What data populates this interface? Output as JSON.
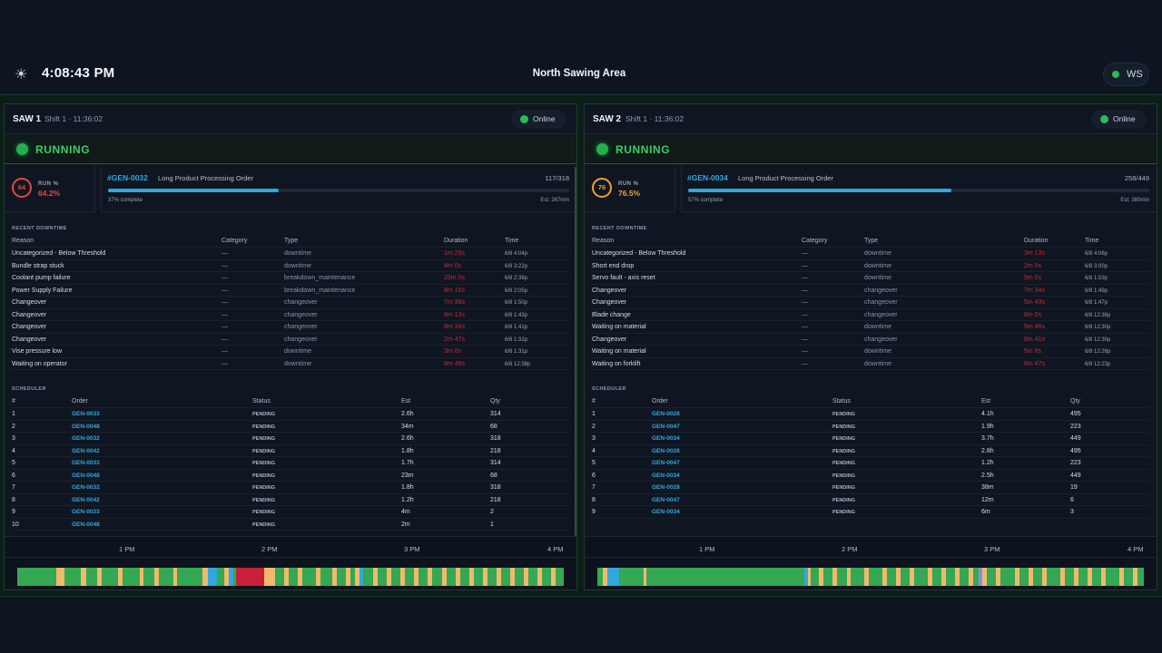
{
  "header": {
    "theme_icon": "sun-icon",
    "clock": "4:08:43 PM",
    "area_title": "North Sawing Area",
    "connection_label": "WS"
  },
  "colors": {
    "running": "#22b04f",
    "online": "#2fba55",
    "downtime": "#c22b3a",
    "changeover": "#f0b96b",
    "progress": "#2fa8de"
  },
  "machines": [
    {
      "name": "SAW 1",
      "shift": "Shift 1 · 11:36:02",
      "status_online": "Online",
      "state": "RUNNING",
      "run_ring": "64",
      "run_label": "RUN %",
      "run_value": "64.2%",
      "run_color": "#e04a45",
      "order_code": "#GEN-0032",
      "order_desc": "Long Product Processing Order",
      "order_qty": "117/318",
      "progress": 0.37,
      "complete_text": "37% complete",
      "est_text": "Est: 267min",
      "downtime_title": "RECENT DOWNTIME",
      "downtime_headers": [
        "Reason",
        "Category",
        "Type",
        "Duration",
        "Time"
      ],
      "downtime": [
        [
          "Uncategorized - Below Threshold",
          "—",
          "downtime",
          "1m 25s",
          "6/8 4:04p"
        ],
        [
          "Bundle strap stuck",
          "—",
          "downtime",
          "4m 0s",
          "6/8 3:22p"
        ],
        [
          "Coolant pump failure",
          "—",
          "breakdown_maintenance",
          "25m 0s",
          "6/8 2:38p"
        ],
        [
          "Power Supply Failure",
          "—",
          "breakdown_maintenance",
          "8m 15s",
          "6/8 2:05p"
        ],
        [
          "Changeover",
          "—",
          "changeover",
          "7m 38s",
          "6/8 1:50p"
        ],
        [
          "Changeover",
          "—",
          "changeover",
          "8m 13s",
          "6/8 1:43p"
        ],
        [
          "Changeover",
          "—",
          "changeover",
          "8m 34s",
          "6/8 1:41p"
        ],
        [
          "Changeover",
          "—",
          "changeover",
          "2m 47s",
          "6/8 1:32p"
        ],
        [
          "Vise pressure low",
          "—",
          "downtime",
          "3m 0s",
          "6/8 1:31p"
        ],
        [
          "Waiting on operator",
          "—",
          "downtime",
          "8m 49s",
          "6/8 12:38p"
        ]
      ],
      "scheduler_title": "SCHEDULER",
      "scheduler_headers": [
        "#",
        "Order",
        "Status",
        "Est",
        "Qty"
      ],
      "scheduler": [
        [
          "1",
          "GEN-0033",
          "PENDING",
          "2.6h",
          "314"
        ],
        [
          "2",
          "GEN-0048",
          "PENDING",
          "34m",
          "68"
        ],
        [
          "3",
          "GEN-0032",
          "PENDING",
          "2.6h",
          "318"
        ],
        [
          "4",
          "GEN-0042",
          "PENDING",
          "1.8h",
          "218"
        ],
        [
          "5",
          "GEN-0033",
          "PENDING",
          "1.7h",
          "314"
        ],
        [
          "6",
          "GEN-0048",
          "PENDING",
          "23m",
          "68"
        ],
        [
          "7",
          "GEN-0032",
          "PENDING",
          "1.8h",
          "318"
        ],
        [
          "8",
          "GEN-0042",
          "PENDING",
          "1.2h",
          "218"
        ],
        [
          "9",
          "GEN-0033",
          "PENDING",
          "4m",
          "2"
        ],
        [
          "10",
          "GEN-0048",
          "PENDING",
          "2m",
          "1"
        ]
      ],
      "timeline_ticks": [
        "1 PM",
        "2 PM",
        "3 PM",
        "4 PM"
      ],
      "timeline_segments": [
        {
          "s": 0.071,
          "e": 0.086,
          "c": "#f0b96b"
        },
        {
          "s": 0.117,
          "e": 0.126,
          "c": "#f0b96b"
        },
        {
          "s": 0.146,
          "e": 0.154,
          "c": "#f0b96b"
        },
        {
          "s": 0.185,
          "e": 0.193,
          "c": "#f0b96b"
        },
        {
          "s": 0.224,
          "e": 0.231,
          "c": "#f0b96b"
        },
        {
          "s": 0.251,
          "e": 0.259,
          "c": "#f0b96b"
        },
        {
          "s": 0.285,
          "e": 0.292,
          "c": "#f0b96b"
        },
        {
          "s": 0.339,
          "e": 0.349,
          "c": "#f0b96b"
        },
        {
          "s": 0.349,
          "e": 0.365,
          "c": "#2fa8de"
        },
        {
          "s": 0.378,
          "e": 0.387,
          "c": "#f0b96b"
        },
        {
          "s": 0.387,
          "e": 0.395,
          "c": "#2fa8de"
        },
        {
          "s": 0.401,
          "e": 0.452,
          "c": "#c8203a"
        },
        {
          "s": 0.452,
          "e": 0.472,
          "c": "#f0b96b"
        },
        {
          "s": 0.488,
          "e": 0.496,
          "c": "#f0b96b"
        },
        {
          "s": 0.513,
          "e": 0.521,
          "c": "#f0b96b"
        },
        {
          "s": 0.546,
          "e": 0.554,
          "c": "#f0b96b"
        },
        {
          "s": 0.576,
          "e": 0.584,
          "c": "#f0b96b"
        },
        {
          "s": 0.601,
          "e": 0.609,
          "c": "#f0b96b"
        },
        {
          "s": 0.618,
          "e": 0.626,
          "c": "#f0b96b"
        },
        {
          "s": 0.626,
          "e": 0.633,
          "c": "#2fa8de"
        },
        {
          "s": 0.651,
          "e": 0.659,
          "c": "#f0b96b"
        },
        {
          "s": 0.676,
          "e": 0.684,
          "c": "#f0b96b"
        },
        {
          "s": 0.701,
          "e": 0.709,
          "c": "#f0b96b"
        },
        {
          "s": 0.726,
          "e": 0.734,
          "c": "#f0b96b"
        },
        {
          "s": 0.751,
          "e": 0.759,
          "c": "#f0b96b"
        },
        {
          "s": 0.777,
          "e": 0.785,
          "c": "#f0b96b"
        },
        {
          "s": 0.802,
          "e": 0.81,
          "c": "#f0b96b"
        },
        {
          "s": 0.827,
          "e": 0.835,
          "c": "#f0b96b"
        },
        {
          "s": 0.852,
          "e": 0.86,
          "c": "#f0b96b"
        },
        {
          "s": 0.877,
          "e": 0.885,
          "c": "#f0b96b"
        },
        {
          "s": 0.902,
          "e": 0.91,
          "c": "#f0b96b"
        },
        {
          "s": 0.927,
          "e": 0.935,
          "c": "#f0b96b"
        },
        {
          "s": 0.952,
          "e": 0.96,
          "c": "#f0b96b"
        },
        {
          "s": 0.977,
          "e": 0.985,
          "c": "#f0b96b"
        }
      ]
    },
    {
      "name": "SAW 2",
      "shift": "Shift 1 · 11:36:02",
      "status_online": "Online",
      "state": "RUNNING",
      "run_ring": "76",
      "run_label": "RUN %",
      "run_value": "76.5%",
      "run_color": "#f0a030",
      "order_code": "#GEN-0034",
      "order_desc": "Long Product Processing Order",
      "order_qty": "258/449",
      "progress": 0.57,
      "complete_text": "57% complete",
      "est_text": "Est: 380min",
      "downtime_title": "RECENT DOWNTIME",
      "downtime_headers": [
        "Reason",
        "Category",
        "Type",
        "Duration",
        "Time"
      ],
      "downtime": [
        [
          "Uncategorized - Below Threshold",
          "—",
          "downtime",
          "3m 13s",
          "6/8 4:06p"
        ],
        [
          "Short end drop",
          "—",
          "downtime",
          "2m 0s",
          "6/8 3:00p"
        ],
        [
          "Servo fault - axis reset",
          "—",
          "downtime",
          "5m 0s",
          "6/8 1:53p"
        ],
        [
          "Changeover",
          "—",
          "changeover",
          "7m 34s",
          "6/8 1:49p"
        ],
        [
          "Changeover",
          "—",
          "changeover",
          "5m 43s",
          "6/8 1:47p"
        ],
        [
          "Blade change",
          "—",
          "changeover",
          "8m 0s",
          "6/8 12:36p"
        ],
        [
          "Waiting on material",
          "—",
          "downtime",
          "5m 46s",
          "6/8 12:30p"
        ],
        [
          "Changeover",
          "—",
          "changeover",
          "6m 41s",
          "6/8 12:30p"
        ],
        [
          "Waiting on material",
          "—",
          "downtime",
          "5m 8s",
          "6/8 12:26p"
        ],
        [
          "Waiting on forklift",
          "—",
          "downtime",
          "6m 47s",
          "6/8 12:23p"
        ]
      ],
      "scheduler_title": "SCHEDULER",
      "scheduler_headers": [
        "#",
        "Order",
        "Status",
        "Est",
        "Qty"
      ],
      "scheduler": [
        [
          "1",
          "GEN-0028",
          "PENDING",
          "4.1h",
          "495"
        ],
        [
          "2",
          "GEN-0047",
          "PENDING",
          "1.9h",
          "223"
        ],
        [
          "3",
          "GEN-0034",
          "PENDING",
          "3.7h",
          "449"
        ],
        [
          "4",
          "GEN-0028",
          "PENDING",
          "2.8h",
          "495"
        ],
        [
          "5",
          "GEN-0047",
          "PENDING",
          "1.2h",
          "223"
        ],
        [
          "6",
          "GEN-0034",
          "PENDING",
          "2.5h",
          "449"
        ],
        [
          "7",
          "GEN-0028",
          "PENDING",
          "38m",
          "19"
        ],
        [
          "8",
          "GEN-0047",
          "PENDING",
          "12m",
          "6"
        ],
        [
          "9",
          "GEN-0034",
          "PENDING",
          "6m",
          "3"
        ]
      ],
      "timeline_ticks": [
        "1 PM",
        "2 PM",
        "3 PM",
        "4 PM"
      ],
      "timeline_segments": [
        {
          "s": 0.01,
          "e": 0.018,
          "c": "#f0b96b"
        },
        {
          "s": 0.018,
          "e": 0.04,
          "c": "#2fa8de"
        },
        {
          "s": 0.085,
          "e": 0.09,
          "c": "#f0b96b"
        },
        {
          "s": 0.379,
          "e": 0.385,
          "c": "#2fa8de"
        },
        {
          "s": 0.385,
          "e": 0.391,
          "c": "#f0b96b"
        },
        {
          "s": 0.406,
          "e": 0.414,
          "c": "#f0b96b"
        },
        {
          "s": 0.431,
          "e": 0.439,
          "c": "#f0b96b"
        },
        {
          "s": 0.456,
          "e": 0.464,
          "c": "#f0b96b"
        },
        {
          "s": 0.489,
          "e": 0.497,
          "c": "#f0b96b"
        },
        {
          "s": 0.522,
          "e": 0.53,
          "c": "#f0b96b"
        },
        {
          "s": 0.547,
          "e": 0.555,
          "c": "#f0b96b"
        },
        {
          "s": 0.572,
          "e": 0.58,
          "c": "#f0b96b"
        },
        {
          "s": 0.605,
          "e": 0.613,
          "c": "#f0b96b"
        },
        {
          "s": 0.63,
          "e": 0.638,
          "c": "#f0b96b"
        },
        {
          "s": 0.655,
          "e": 0.663,
          "c": "#f0b96b"
        },
        {
          "s": 0.68,
          "e": 0.688,
          "c": "#f0b96b"
        },
        {
          "s": 0.697,
          "e": 0.705,
          "c": "#8a8ce0"
        },
        {
          "s": 0.705,
          "e": 0.713,
          "c": "#f0b96b"
        },
        {
          "s": 0.73,
          "e": 0.738,
          "c": "#f0b96b"
        },
        {
          "s": 0.764,
          "e": 0.772,
          "c": "#f0b96b"
        },
        {
          "s": 0.789,
          "e": 0.797,
          "c": "#f0b96b"
        },
        {
          "s": 0.814,
          "e": 0.822,
          "c": "#f0b96b"
        },
        {
          "s": 0.847,
          "e": 0.855,
          "c": "#f0b96b"
        },
        {
          "s": 0.872,
          "e": 0.88,
          "c": "#f0b96b"
        },
        {
          "s": 0.897,
          "e": 0.905,
          "c": "#f0b96b"
        },
        {
          "s": 0.922,
          "e": 0.93,
          "c": "#f0b96b"
        },
        {
          "s": 0.955,
          "e": 0.963,
          "c": "#f0b96b"
        },
        {
          "s": 0.98,
          "e": 0.988,
          "c": "#f0b96b"
        }
      ]
    }
  ]
}
